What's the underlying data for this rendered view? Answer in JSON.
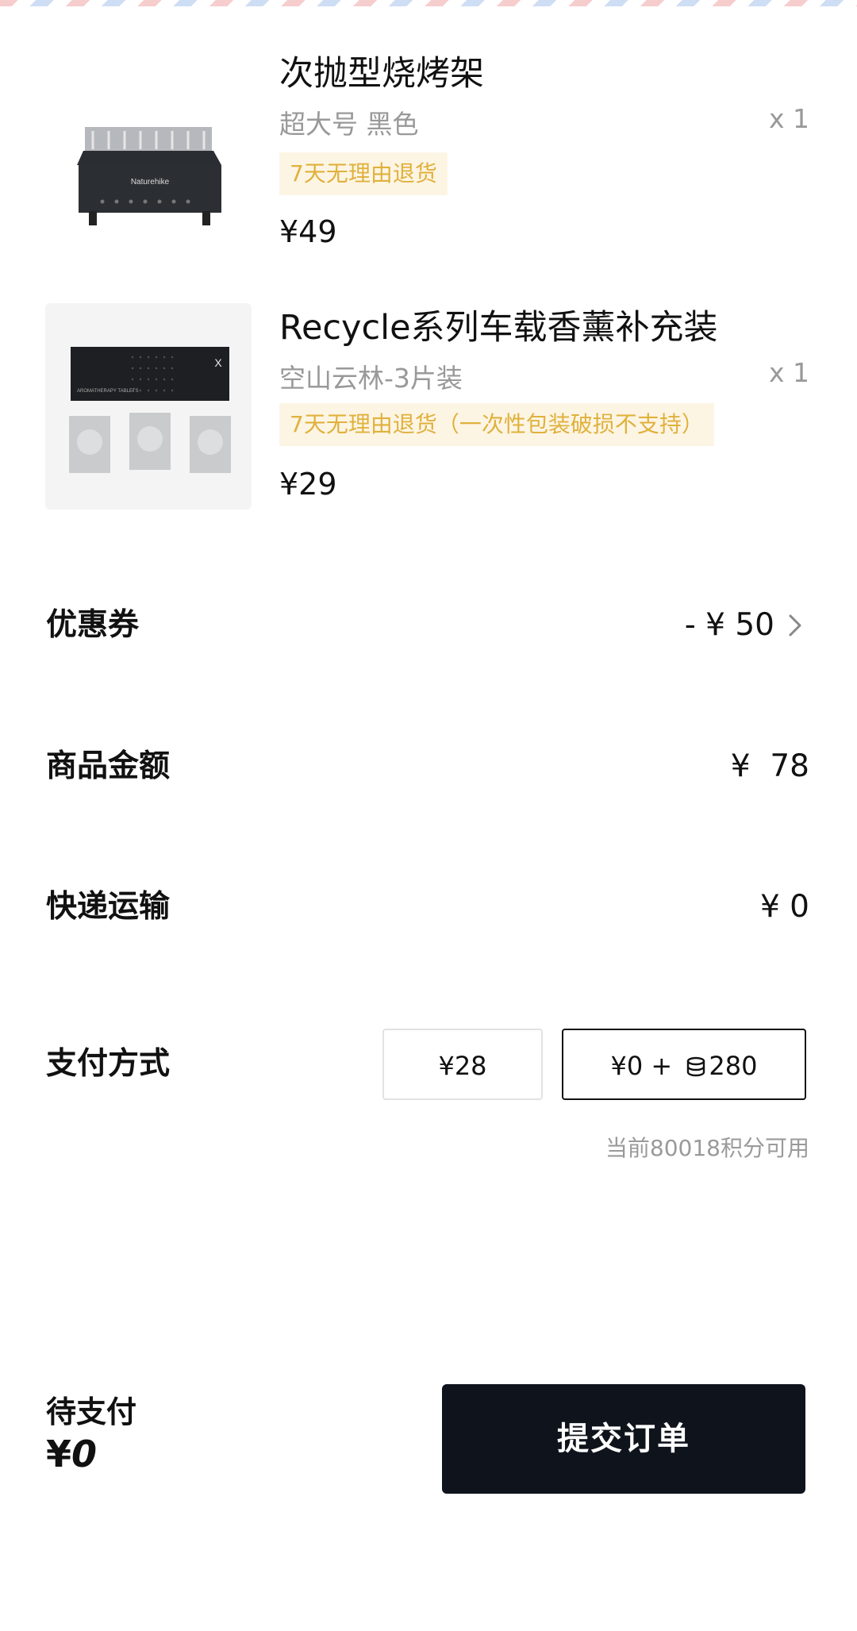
{
  "items": [
    {
      "name": "次抛型烧烤架",
      "spec": "超大号 黑色",
      "qty": "x 1",
      "tag": "7天无理由退货",
      "price": "¥49",
      "image_icon": "grill-product-image",
      "brand_text": "Naturehike"
    },
    {
      "name": "Recycle系列车载香薰补充装",
      "spec": "空山云林-3片装",
      "qty": "x 1",
      "tag": "7天无理由退货（一次性包装破损不支持）",
      "price": "¥29",
      "image_icon": "aroma-refill-product-image",
      "package_text": "AROMATHERAPY TABLETS"
    }
  ],
  "summary": {
    "coupon_label": "优惠券",
    "coupon_value": "- ¥ 50",
    "subtotal_label": "商品金额",
    "subtotal_value": "¥  78",
    "shipping_label": "快递运输",
    "shipping_value": "¥ 0"
  },
  "payment": {
    "label": "支付方式",
    "option_cash": "¥28",
    "option_mixed_cash": "¥0 +",
    "option_mixed_points": "280",
    "points_icon": "coin-stack-icon",
    "points_hint": "当前80018积分可用"
  },
  "footer": {
    "due_label": "待支付",
    "due_currency": "¥",
    "due_amount": "0",
    "submit_label": "提交订单"
  },
  "colors": {
    "tag_bg": "#fdf5e4",
    "tag_text": "#e0b13d",
    "button_bg": "#0f141c",
    "muted_text": "#999999"
  }
}
